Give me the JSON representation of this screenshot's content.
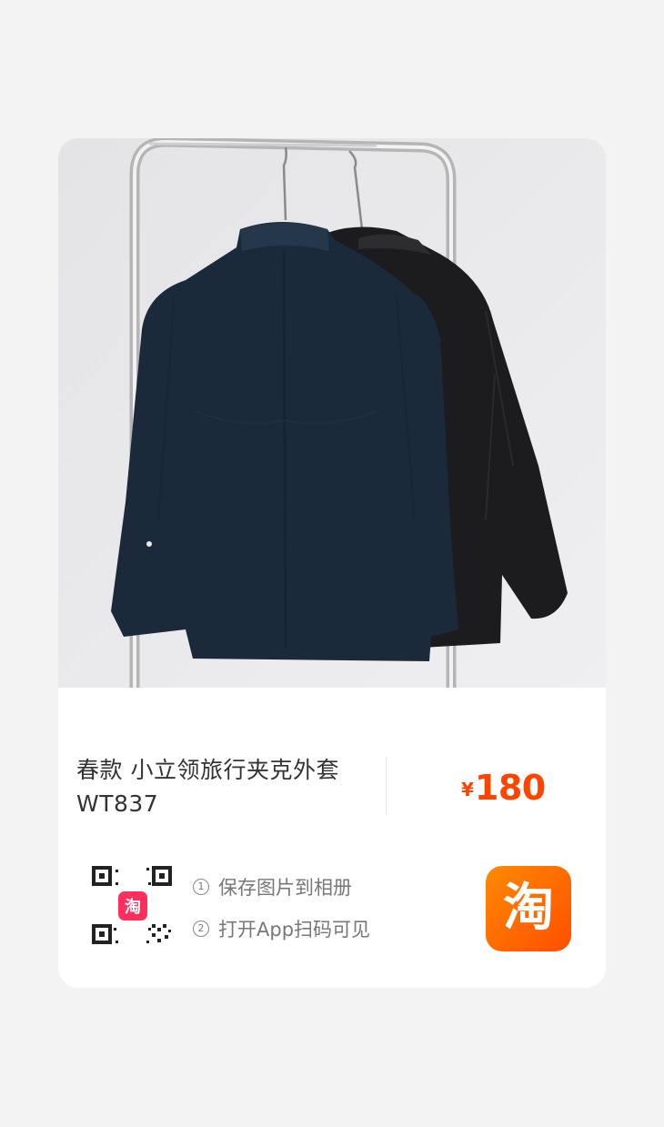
{
  "product": {
    "title": "春款 小立领旅行夹克外套WT837",
    "price_currency": "¥",
    "price_amount": "180"
  },
  "share": {
    "steps": [
      {
        "num": "1",
        "text": "保存图片到相册"
      },
      {
        "num": "2",
        "text": "打开App扫码可见"
      }
    ],
    "qr_badge_glyph": "淘",
    "app_icon_glyph": "淘"
  },
  "colors": {
    "price": "#ff4400",
    "brand_orange": "#ff5000"
  }
}
